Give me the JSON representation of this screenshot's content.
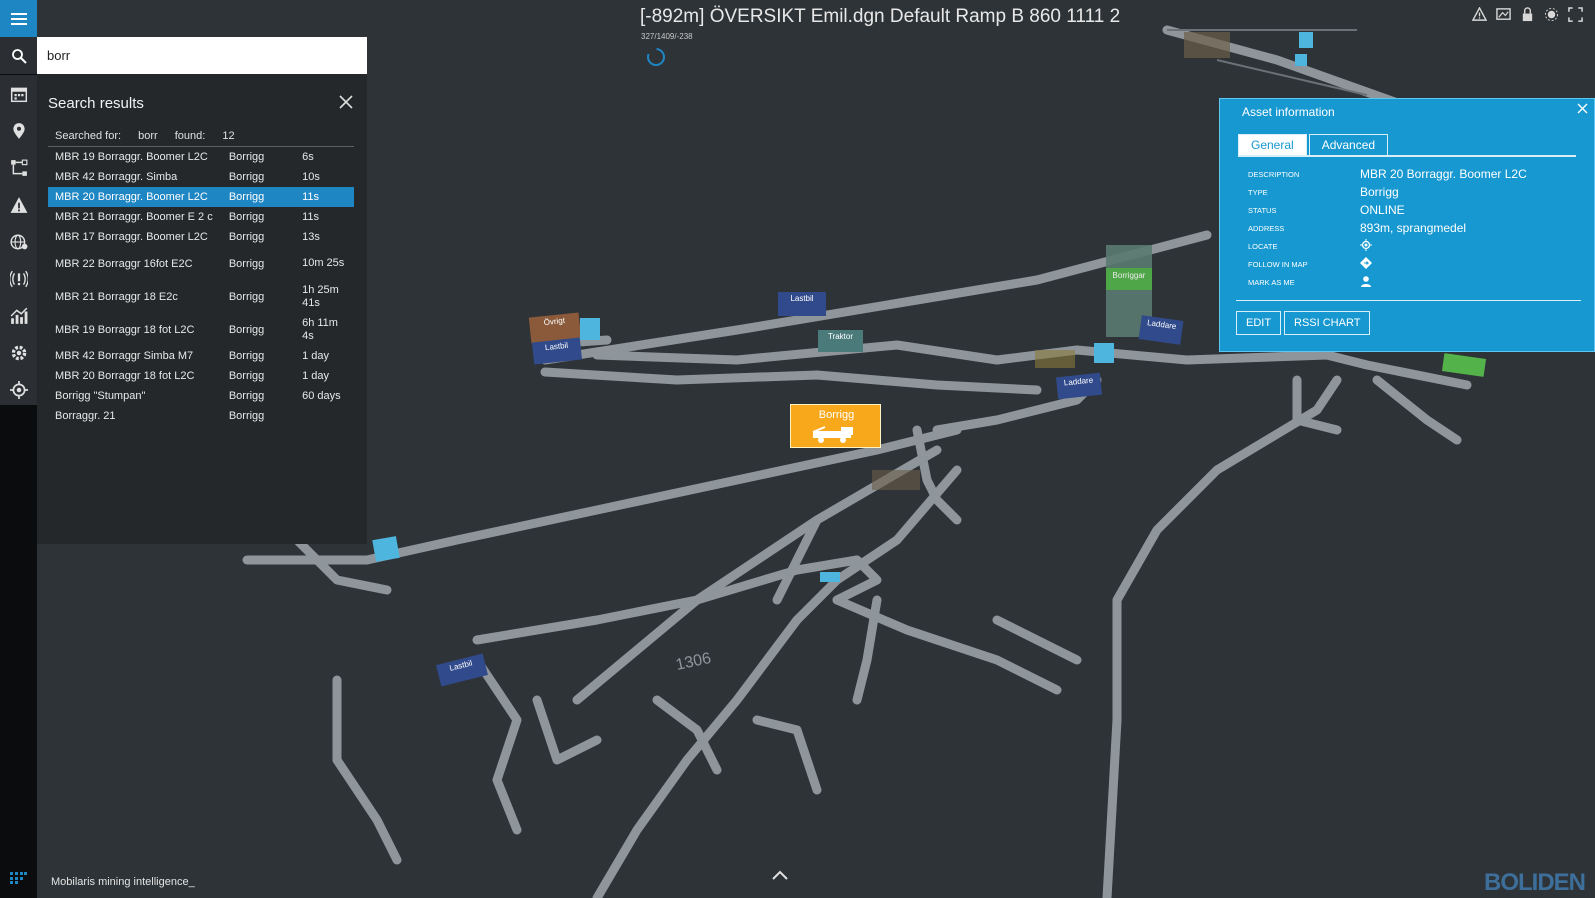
{
  "search": {
    "query": "borr"
  },
  "panel": {
    "title": "Search results",
    "searched_for_label": "Searched for:",
    "searched_for_value": "borr",
    "found_label": "found:",
    "found_value": "12",
    "results": [
      {
        "name": "MBR 19 Borraggr. Boomer L2C",
        "type": "Borrigg",
        "time": "6s"
      },
      {
        "name": "MBR 42 Borraggr. Simba",
        "type": "Borrigg",
        "time": "10s"
      },
      {
        "name": "MBR 20 Borraggr. Boomer L2C",
        "type": "Borrigg",
        "time": "11s",
        "selected": true
      },
      {
        "name": "MBR 21 Borraggr. Boomer E 2 c",
        "type": "Borrigg",
        "time": "11s"
      },
      {
        "name": "MBR 17 Borraggr. Boomer L2C",
        "type": "Borrigg",
        "time": "13s"
      },
      {
        "name": "MBR 22 Borraggr 16fot E2C",
        "type": "Borrigg",
        "time": "10m 25s"
      },
      {
        "name": "MBR 21 Borraggr 18 E2c",
        "type": "Borrigg",
        "time": "1h 25m 41s"
      },
      {
        "name": "MBR 19 Borraggr 18 fot L2C",
        "type": "Borrigg",
        "time": "6h 11m 4s"
      },
      {
        "name": "MBR 42 Borraggr Simba M7",
        "type": "Borrigg",
        "time": "1 day"
      },
      {
        "name": "MBR 20 Borraggr 18 fot L2C",
        "type": "Borrigg",
        "time": "1 day"
      },
      {
        "name": "Borrigg \"Stumpan\"",
        "type": "Borrigg",
        "time": "60 days"
      },
      {
        "name": "Borraggr. 21",
        "type": "Borrigg",
        "time": ""
      }
    ]
  },
  "map": {
    "title": "[-892m] ÖVERSIKT Emil.dgn Default Ramp B 860 1111 2",
    "coords": "327/1409/-238",
    "selected_marker_label": "Borrigg",
    "marker_labels": [
      "Övrigt",
      "Lastbil",
      "Lastbil",
      "Traktor",
      "Borriggar",
      "Laddare",
      "Laddare",
      "Lastbil",
      "Borrigg"
    ],
    "tunnel_number": "1306"
  },
  "asset": {
    "title": "Asset information",
    "tabs": [
      "General",
      "Advanced"
    ],
    "fields": {
      "description_label": "DESCRIPTION",
      "description": "MBR 20 Borraggr. Boomer L2C",
      "type_label": "TYPE",
      "type": "Borrigg",
      "status_label": "STATUS",
      "status": "ONLINE",
      "address_label": "ADDRESS",
      "address": "893m, sprangmedel",
      "locate_label": "LOCATE",
      "follow_label": "FOLLOW IN MAP",
      "mark_label": "MARK AS ME"
    },
    "edit_button": "EDIT",
    "rssi_button": "RSSI CHART"
  },
  "footer": {
    "text": "Mobilaris mining intelligence_"
  },
  "brand": {
    "logo": "BOLIDEN"
  },
  "colors": {
    "accent": "#1f86c4",
    "panel_info": "#1798d0",
    "marker_selected": "#f7a81b",
    "background": "#2e3337"
  },
  "icons": [
    "menu-icon",
    "search-icon",
    "calendar-icon",
    "location-pin-icon",
    "route-icon",
    "warning-icon",
    "globe-icon",
    "alarm-icon",
    "chart-icon",
    "gear-icon",
    "crosshair-icon"
  ]
}
